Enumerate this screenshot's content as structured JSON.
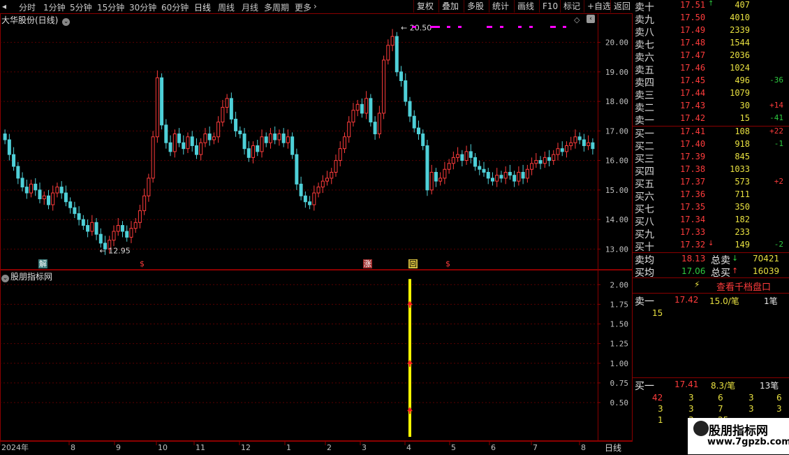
{
  "toolbar": {
    "periods": [
      "分时",
      "1分钟",
      "5分钟",
      "15分钟",
      "30分钟",
      "60分钟",
      "日线",
      "周线",
      "月线",
      "多周期",
      "更多"
    ],
    "active_period": "日线",
    "buttons": [
      "复权",
      "叠加",
      "多股",
      "统计",
      "画线",
      "F10",
      "标记",
      "+自选",
      "返回"
    ]
  },
  "main_chart": {
    "stock_title": "大华股份(日线)",
    "high_marker": "20.50",
    "low_marker": "12.95",
    "price_ticks": [
      "20.00",
      "19.00",
      "18.00",
      "17.00",
      "16.00",
      "15.00",
      "14.00",
      "13.00"
    ],
    "event_tags": [
      {
        "label": "解",
        "kind": "unlock"
      },
      {
        "label": "$",
        "kind": "dividend"
      },
      {
        "label": "涨",
        "kind": "limit"
      },
      {
        "label": "回",
        "kind": "buyback"
      },
      {
        "label": "$",
        "kind": "dividend"
      }
    ]
  },
  "chart_data": {
    "type": "candlestick",
    "title": "大华股份(日线)",
    "x_labels": [
      "2024年",
      "8",
      "9",
      "10",
      "11",
      "12",
      "1",
      "2",
      "3",
      "4",
      "5",
      "6",
      "7",
      "8"
    ],
    "ylim": [
      12.7,
      20.7
    ],
    "closes": [
      16.7,
      16.2,
      15.8,
      15.4,
      15.1,
      14.9,
      15.2,
      15.0,
      14.7,
      14.8,
      14.5,
      14.9,
      15.1,
      14.9,
      14.6,
      14.4,
      14.2,
      14.0,
      13.8,
      13.6,
      13.9,
      13.5,
      13.2,
      13.0,
      13.3,
      13.6,
      13.8,
      13.6,
      13.4,
      13.7,
      13.9,
      14.3,
      14.8,
      15.4,
      16.8,
      18.8,
      17.2,
      16.6,
      16.3,
      16.9,
      16.6,
      16.4,
      16.8,
      16.5,
      16.2,
      16.6,
      16.9,
      16.7,
      16.8,
      17.3,
      17.8,
      18.1,
      17.4,
      17.0,
      16.9,
      16.4,
      16.1,
      16.5,
      16.3,
      16.8,
      16.6,
      16.9,
      16.7,
      16.9,
      16.6,
      16.8,
      16.2,
      15.2,
      14.8,
      14.6,
      14.5,
      14.9,
      15.1,
      15.3,
      15.4,
      15.6,
      16.0,
      16.4,
      16.8,
      17.3,
      17.7,
      17.9,
      17.6,
      18.1,
      17.3,
      16.9,
      17.6,
      19.4,
      19.9,
      20.2,
      19.0,
      18.7,
      18.0,
      17.5,
      17.1,
      16.9,
      16.5,
      15.0,
      15.6,
      15.3,
      15.4,
      15.7,
      15.9,
      16.1,
      16.2,
      16.0,
      16.3,
      16.1,
      15.8,
      15.7,
      15.6,
      15.4,
      15.3,
      15.5,
      15.4,
      15.6,
      15.5,
      15.3,
      15.6,
      15.4,
      15.7,
      15.9,
      16.0,
      15.9,
      16.1,
      16.0,
      16.2,
      16.4,
      16.3,
      16.5,
      16.6,
      16.8,
      16.7,
      16.5,
      16.6,
      16.4
    ],
    "indicator_ylim": [
      0.1,
      2.1
    ],
    "indicator_ticks": [
      "2.00",
      "1.75",
      "1.50",
      "1.25",
      "1.00",
      "0.75",
      "0.50"
    ],
    "signal_bar": {
      "x_index": 93,
      "value": 2.0,
      "arrows": [
        1.75,
        1.0,
        0.4
      ]
    }
  },
  "indicator": {
    "title": "股朋指标网"
  },
  "axis": {
    "period_label": "日线"
  },
  "orderbook": {
    "asks": [
      {
        "label": "卖十",
        "price": "17.51",
        "vol": "407",
        "chg": "",
        "arrow": "up"
      },
      {
        "label": "卖九",
        "price": "17.50",
        "vol": "4010",
        "chg": ""
      },
      {
        "label": "卖八",
        "price": "17.49",
        "vol": "2339",
        "chg": ""
      },
      {
        "label": "卖七",
        "price": "17.48",
        "vol": "1544",
        "chg": ""
      },
      {
        "label": "卖六",
        "price": "17.47",
        "vol": "2036",
        "chg": ""
      },
      {
        "label": "卖五",
        "price": "17.46",
        "vol": "1024",
        "chg": ""
      },
      {
        "label": "卖四",
        "price": "17.45",
        "vol": "496",
        "chg": "-36"
      },
      {
        "label": "卖三",
        "price": "17.44",
        "vol": "1079",
        "chg": ""
      },
      {
        "label": "卖二",
        "price": "17.43",
        "vol": "30",
        "chg": "+14"
      },
      {
        "label": "卖一",
        "price": "17.42",
        "vol": "15",
        "chg": "-41"
      }
    ],
    "bids": [
      {
        "label": "买一",
        "price": "17.41",
        "vol": "108",
        "chg": "+22"
      },
      {
        "label": "买二",
        "price": "17.40",
        "vol": "918",
        "chg": "-1"
      },
      {
        "label": "买三",
        "price": "17.39",
        "vol": "845",
        "chg": ""
      },
      {
        "label": "买四",
        "price": "17.38",
        "vol": "1033",
        "chg": ""
      },
      {
        "label": "买五",
        "price": "17.37",
        "vol": "573",
        "chg": "+2"
      },
      {
        "label": "买六",
        "price": "17.36",
        "vol": "711",
        "chg": ""
      },
      {
        "label": "买七",
        "price": "17.35",
        "vol": "350",
        "chg": ""
      },
      {
        "label": "买八",
        "price": "17.34",
        "vol": "182",
        "chg": ""
      },
      {
        "label": "买九",
        "price": "17.33",
        "vol": "233",
        "chg": ""
      },
      {
        "label": "买十",
        "price": "17.32",
        "vol": "149",
        "chg": "-2",
        "arrow": "down"
      }
    ],
    "avg_sell_label": "卖均",
    "avg_sell": "18.13",
    "total_sell_label": "总卖",
    "total_sell": "70421",
    "avg_buy_label": "买均",
    "avg_buy": "17.06",
    "total_buy_label": "总买",
    "total_buy": "16039",
    "view_level_button": "查看千档盘口",
    "ask1_detail": {
      "label": "卖一",
      "price": "17.42",
      "per": "15.0/笔",
      "count": "1笔",
      "orders": [
        "15"
      ]
    },
    "bid1_detail": {
      "label": "买一",
      "price": "17.41",
      "per": "8.3/笔",
      "count": "13笔",
      "orders": [
        [
          "42",
          "3",
          "6",
          "3",
          "6"
        ],
        [
          "3",
          "3",
          "7",
          "3",
          "3"
        ],
        [
          "1",
          "3",
          "25"
        ]
      ]
    }
  },
  "watermark": {
    "line1": "股朋指标网",
    "line2": "www.7gpzb.com"
  },
  "colors": {
    "up": "#ff3c3c",
    "down": "#4fd0d8",
    "frame": "#8b0000",
    "signal": "#ffff00",
    "magenta": "#ff00ff"
  }
}
